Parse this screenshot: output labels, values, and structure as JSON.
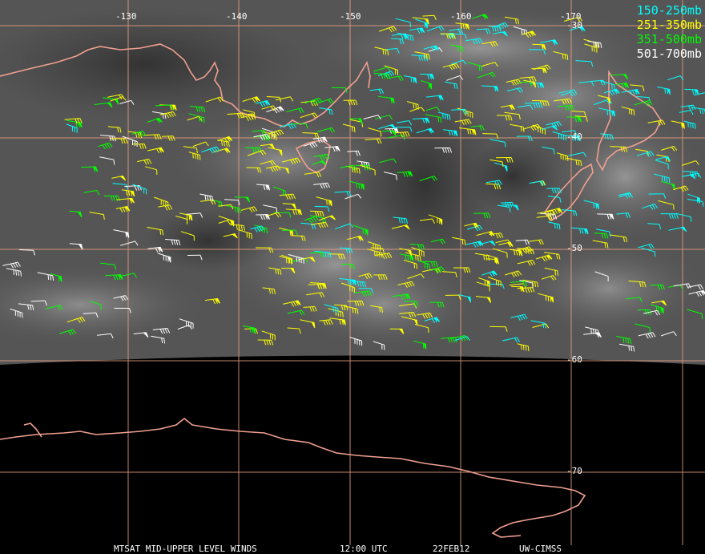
{
  "map": {
    "projection": "mercator",
    "lon_labels": [
      "-130",
      "-140",
      "-150",
      "-160",
      "-170"
    ],
    "lat_labels": [
      "-30",
      "-40",
      "-50",
      "-60",
      "-70"
    ],
    "colors": {
      "grid": "#e8a080",
      "coast": "#f0a090",
      "space": "#000000"
    }
  },
  "legend": [
    {
      "label": "150-250mb",
      "color": "#00ffff"
    },
    {
      "label": "251-350mb",
      "color": "#ffff00"
    },
    {
      "label": "351-500mb",
      "color": "#00ff00"
    },
    {
      "label": "501-700mb",
      "color": "#ffffff"
    }
  ],
  "footer": {
    "product": "MTSAT MID-UPPER LEVEL WINDS",
    "time": "12:00 UTC",
    "date": "22FEB12",
    "source": "UW-CIMSS"
  }
}
